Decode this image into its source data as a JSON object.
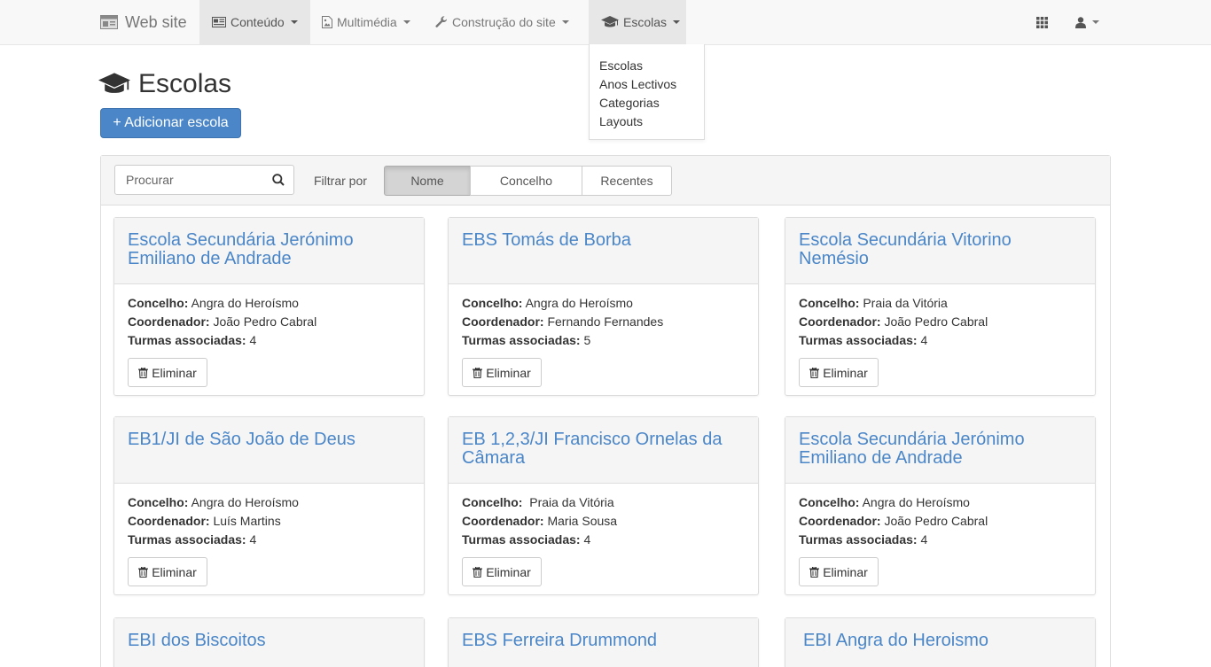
{
  "navbar": {
    "brand": "Web site",
    "items": [
      {
        "label": "Conteúdo",
        "icon": "newspaper-icon"
      },
      {
        "label": "Multimédia",
        "icon": "image-icon"
      },
      {
        "label": "Construção do site",
        "icon": "wrench-icon"
      },
      {
        "label": "Escolas",
        "icon": "graduation-cap-icon"
      }
    ]
  },
  "dropdown": {
    "items": [
      "Escolas",
      "Anos Lectivos",
      "Categorias",
      "Layouts"
    ]
  },
  "page": {
    "title": "Escolas",
    "add_button": "+ Adicionar escola"
  },
  "filters": {
    "search_placeholder": "Procurar",
    "label": "Filtrar por",
    "options": [
      "Nome",
      "Concelho",
      "Recentes"
    ],
    "active": "Nome"
  },
  "labels": {
    "concelho": "Concelho:",
    "coordenador": "Coordenador:",
    "turmas": "Turmas associadas:",
    "delete": "Eliminar"
  },
  "schools": [
    {
      "name": "Escola Secundária Jerónimo Emiliano de Andrade",
      "concelho": "Angra do Heroísmo",
      "coordenador": "João Pedro Cabral",
      "turmas": "4"
    },
    {
      "name": "EBS Tomás de Borba",
      "concelho": "Angra do Heroísmo",
      "coordenador": "Fernando Fernandes",
      "turmas": "5"
    },
    {
      "name": "Escola Secundária Vitorino Nemésio",
      "concelho": "Praia da Vitória",
      "coordenador": "João Pedro Cabral",
      "turmas": "4"
    },
    {
      "name": "EB1/JI de São João de Deus",
      "concelho": "Angra do Heroísmo",
      "coordenador": "Luís Martins",
      "turmas": "4"
    },
    {
      "name": "EB 1,2,3/JI Francisco Ornelas da Câmara",
      "concelho": " Praia da Vitória",
      "coordenador": "Maria Sousa",
      "turmas": "4"
    },
    {
      "name": "Escola Secundária Jerónimo Emiliano de Andrade",
      "concelho": "Angra do Heroísmo",
      "coordenador": "João Pedro Cabral",
      "turmas": "4"
    },
    {
      "name": "EBI dos Biscoitos"
    },
    {
      "name": "EBS Ferreira Drummond"
    },
    {
      "name": "EBI Angra do Heroismo"
    }
  ]
}
